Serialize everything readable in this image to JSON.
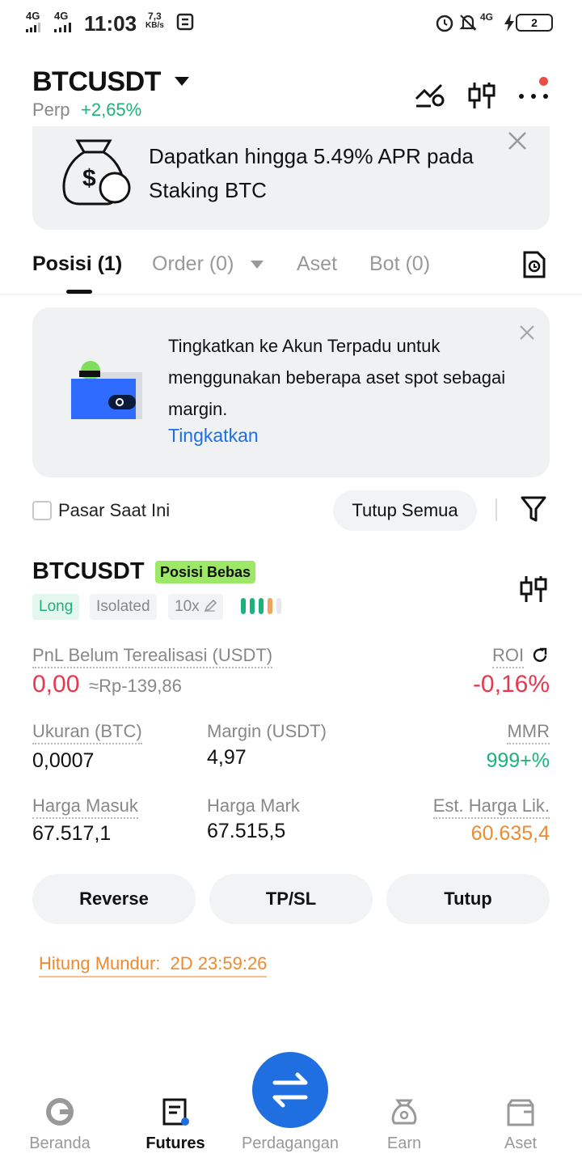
{
  "status_bar": {
    "net1": "4G",
    "net2": "4G",
    "time": "11:03",
    "speed_value": "7,3",
    "speed_unit": "KB/s",
    "net3": "4G",
    "battery": "2"
  },
  "header": {
    "pair": "BTCUSDT",
    "perp_label": "Perp",
    "change": "+2,65%"
  },
  "promo_banner": {
    "text": "Dapatkan hingga 5.49% APR pada Staking BTC"
  },
  "tabs": [
    {
      "label": "Posisi (1)",
      "active": true
    },
    {
      "label": "Order (0)",
      "active": false
    },
    {
      "label": "Aset",
      "active": false
    },
    {
      "label": "Bot (0)",
      "active": false
    }
  ],
  "upgrade_banner": {
    "text": "Tingkatkan ke Akun Terpadu untuk menggunakan beberapa aset spot sebagai margin.",
    "link": "Tingkatkan"
  },
  "filters": {
    "current_market_label": "Pasar Saat Ini",
    "close_all_label": "Tutup Semua"
  },
  "position": {
    "symbol": "BTCUSDT",
    "mode_badge": "Posisi Bebas",
    "side": "Long",
    "margin_type": "Isolated",
    "leverage": "10x",
    "pnl_label": "PnL Belum Terealisasi (USDT)",
    "pnl_value": "0,00",
    "pnl_fiat": "≈Rp-139,86",
    "roi_label": "ROI",
    "roi_value": "-0,16%",
    "size_label": "Ukuran (BTC)",
    "size_value": "0,0007",
    "margin_label": "Margin (USDT)",
    "margin_value": "4,97",
    "mmr_label": "MMR",
    "mmr_value": "999+%",
    "entry_label": "Harga Masuk",
    "entry_value": "67.517,1",
    "mark_label": "Harga Mark",
    "mark_value": "67.515,5",
    "liq_label": "Est. Harga Lik.",
    "liq_value": "60.635,4"
  },
  "actions": {
    "reverse": "Reverse",
    "tpsl": "TP/SL",
    "close": "Tutup"
  },
  "countdown": {
    "label": "Hitung Mundur:",
    "value": "2D 23:59:26"
  },
  "bottom_nav": [
    {
      "label": "Beranda",
      "active": false
    },
    {
      "label": "Futures",
      "active": true
    },
    {
      "label": "Perdagangan",
      "active": false
    },
    {
      "label": "Earn",
      "active": false
    },
    {
      "label": "Aset",
      "active": false
    }
  ],
  "colors": {
    "green": "#1db27b",
    "red": "#e8384f",
    "orange": "#ef8a2e",
    "blue": "#1f6fe0",
    "badge_green": "#9de866"
  },
  "icons": [
    "signal-icon",
    "alarm-icon",
    "mute-icon",
    "charging-icon",
    "battery-icon",
    "money-bag-icon",
    "close-icon",
    "history-icon",
    "wallet-icon",
    "filter-icon",
    "candlestick-icon",
    "share-icon",
    "edit-icon",
    "home-icon",
    "futures-icon",
    "swap-icon",
    "earn-icon",
    "wallet-nav-icon"
  ]
}
